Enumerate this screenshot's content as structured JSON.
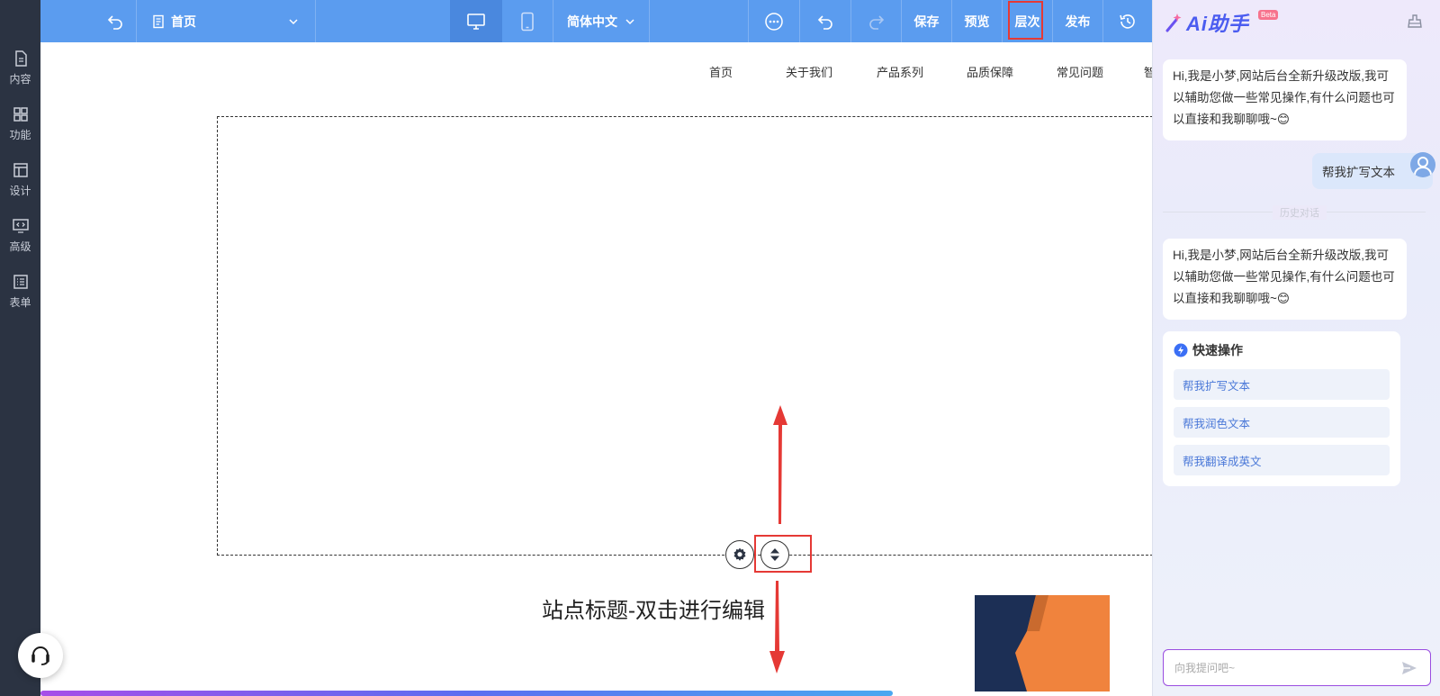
{
  "toolbar": {
    "page_select": "首页",
    "language": "简体中文",
    "save": "保存",
    "preview": "预览",
    "layers": "层次",
    "publish": "发布"
  },
  "sidebar": {
    "items": [
      {
        "label": "内容",
        "icon": "file-icon"
      },
      {
        "label": "功能",
        "icon": "grid-icon"
      },
      {
        "label": "设计",
        "icon": "layout-icon"
      },
      {
        "label": "高级",
        "icon": "code-icon"
      },
      {
        "label": "表单",
        "icon": "list-icon"
      }
    ]
  },
  "site_nav": {
    "items": [
      "首页",
      "关于我们",
      "产品系列",
      "品质保障",
      "常见问题",
      "智"
    ]
  },
  "canvas": {
    "site_title": "站点标题-双击进行编辑"
  },
  "ai": {
    "title": "Ai助手",
    "badge": "Beta",
    "greeting": "Hi,我是小梦,网站后台全新升级改版,我可以辅助您做一些常见操作,有什么问题也可以直接和我聊聊哦~😊",
    "user_message": "帮我扩写文本",
    "history_divider": "历史对话",
    "greeting_repeat": "Hi,我是小梦,网站后台全新升级改版,我可以辅助您做一些常见操作,有什么问题也可以直接和我聊聊哦~😊",
    "quick_title": "快速操作",
    "quick_actions": [
      "帮我扩写文本",
      "帮我润色文本",
      "帮我翻译成英文"
    ],
    "input_placeholder": "向我提问吧~"
  },
  "colors": {
    "toolbar": "#5b9cef",
    "sidebar": "#2b3342",
    "highlight": "#e53935",
    "ai_accent": "#4b5cf0"
  }
}
